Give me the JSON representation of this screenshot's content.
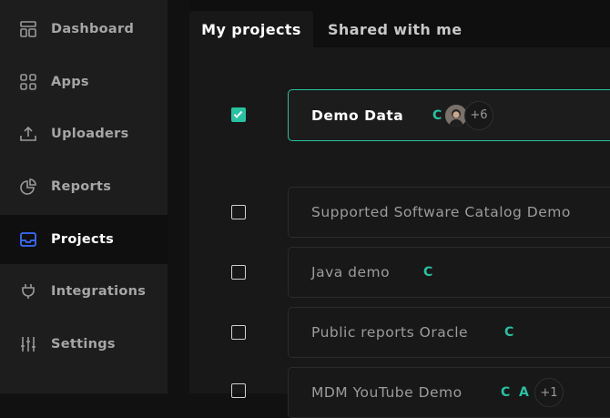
{
  "sidebar": {
    "items": [
      {
        "label": "Dashboard",
        "icon": "dashboard-icon"
      },
      {
        "label": "Apps",
        "icon": "apps-icon"
      },
      {
        "label": "Uploaders",
        "icon": "upload-icon"
      },
      {
        "label": "Reports",
        "icon": "pie-chart-icon"
      },
      {
        "label": "Projects",
        "icon": "inbox-icon",
        "active": true
      },
      {
        "label": "Integrations",
        "icon": "plug-icon"
      },
      {
        "label": "Settings",
        "icon": "sliders-icon"
      }
    ]
  },
  "tabs": [
    {
      "label": "My projects",
      "active": true
    },
    {
      "label": "Shared with me",
      "active": false
    }
  ],
  "projects": [
    {
      "name": "Demo Data",
      "checked": true,
      "badges": [
        "C"
      ],
      "extra_count": "+6"
    },
    {
      "name": "Supported Software Catalog Demo",
      "checked": false
    },
    {
      "name": "Java demo",
      "checked": false,
      "badges": [
        "C"
      ]
    },
    {
      "name": "Public reports Oracle",
      "checked": false,
      "badges": [
        "C"
      ]
    },
    {
      "name": "MDM YouTube Demo",
      "checked": false,
      "badges": [
        "C",
        "A"
      ],
      "extra_count": "+1"
    }
  ],
  "colors": {
    "accent": "#27c2a1",
    "active_nav_icon": "#3b6cff",
    "sidebar_bg": "#1d1d1d",
    "main_bg": "#181818"
  }
}
